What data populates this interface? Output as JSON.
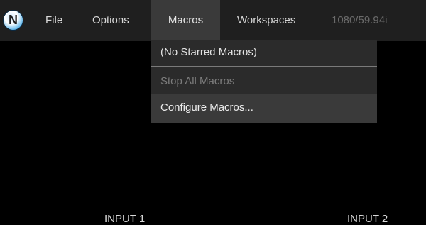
{
  "menubar": {
    "logo_letter": "N",
    "items": [
      {
        "label": "File"
      },
      {
        "label": "Options"
      },
      {
        "label": "Macros"
      },
      {
        "label": "Workspaces"
      }
    ],
    "resolution": "1080/59.94i"
  },
  "macros_menu": {
    "starred": "(No Starred Macros)",
    "stop_all": "Stop All Macros",
    "configure": "Configure Macros..."
  },
  "inputs": [
    "INPUT 1",
    "INPUT 2"
  ],
  "colors": {
    "menubar_bg": "#1f1f1f",
    "menu_active_bg": "#3a3a3a",
    "dropdown_bg": "#2b2b2b",
    "disabled_text": "#7d7d7d"
  }
}
